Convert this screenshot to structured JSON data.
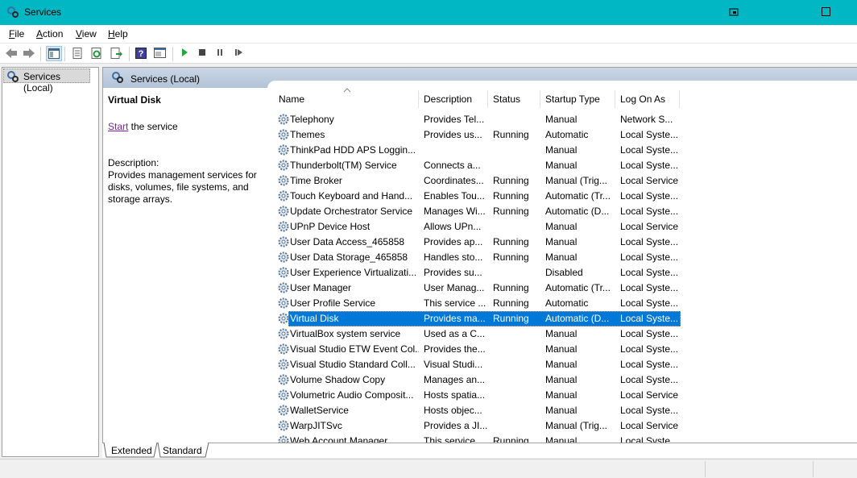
{
  "window": {
    "title": "Services",
    "icon": "services-gear-icon"
  },
  "menu": [
    {
      "label": "File",
      "key": "F",
      "rest": "ile"
    },
    {
      "label": "Action",
      "key": "A",
      "rest": "ction"
    },
    {
      "label": "View",
      "key": "V",
      "rest": "iew"
    },
    {
      "label": "Help",
      "key": "H",
      "rest": "elp"
    }
  ],
  "toolbar": {
    "icons": [
      "back-arrow-icon",
      "forward-arrow-icon",
      "show-hide-tree-icon",
      "properties-icon",
      "refresh-icon",
      "export-list-icon",
      "help-icon",
      "show-action-pane-icon",
      "start-service-icon",
      "stop-service-icon",
      "pause-service-icon",
      "restart-service-icon"
    ]
  },
  "tree": {
    "root_label": "Services (Local)"
  },
  "pane_header": "Services (Local)",
  "details": {
    "title": "Virtual Disk",
    "start_link": "Start",
    "start_rest": " the service",
    "description_label": "Description:",
    "description_text": "Provides management services for disks, volumes, file systems, and storage arrays."
  },
  "columns": [
    "Name",
    "Description",
    "Status",
    "Startup Type",
    "Log On As"
  ],
  "rows": [
    {
      "name": "Telephony",
      "desc": "Provides Tel...",
      "status": "",
      "startup": "Manual",
      "logon": "Network S..."
    },
    {
      "name": "Themes",
      "desc": "Provides us...",
      "status": "Running",
      "startup": "Automatic",
      "logon": "Local Syste..."
    },
    {
      "name": "ThinkPad HDD APS Loggin...",
      "desc": "",
      "status": "",
      "startup": "Manual",
      "logon": "Local Syste..."
    },
    {
      "name": "Thunderbolt(TM) Service",
      "desc": "Connects a...",
      "status": "",
      "startup": "Manual",
      "logon": "Local Syste..."
    },
    {
      "name": "Time Broker",
      "desc": "Coordinates...",
      "status": "Running",
      "startup": "Manual (Trig...",
      "logon": "Local Service"
    },
    {
      "name": "Touch Keyboard and Hand...",
      "desc": "Enables Tou...",
      "status": "Running",
      "startup": "Automatic (Tr...",
      "logon": "Local Syste..."
    },
    {
      "name": "Update Orchestrator Service",
      "desc": "Manages Wi...",
      "status": "Running",
      "startup": "Automatic (D...",
      "logon": "Local Syste..."
    },
    {
      "name": "UPnP Device Host",
      "desc": "Allows UPn...",
      "status": "",
      "startup": "Manual",
      "logon": "Local Service"
    },
    {
      "name": "User Data Access_465858",
      "desc": "Provides ap...",
      "status": "Running",
      "startup": "Manual",
      "logon": "Local Syste..."
    },
    {
      "name": "User Data Storage_465858",
      "desc": "Handles sto...",
      "status": "Running",
      "startup": "Manual",
      "logon": "Local Syste..."
    },
    {
      "name": "User Experience Virtualizati...",
      "desc": "Provides su...",
      "status": "",
      "startup": "Disabled",
      "logon": "Local Syste..."
    },
    {
      "name": "User Manager",
      "desc": "User Manag...",
      "status": "Running",
      "startup": "Automatic (Tr...",
      "logon": "Local Syste..."
    },
    {
      "name": "User Profile Service",
      "desc": "This service ...",
      "status": "Running",
      "startup": "Automatic",
      "logon": "Local Syste..."
    },
    {
      "name": "Virtual Disk",
      "desc": "Provides ma...",
      "status": "Running",
      "startup": "Automatic (D...",
      "logon": "Local Syste...",
      "selected": true
    },
    {
      "name": "VirtualBox system service",
      "desc": "Used as a C...",
      "status": "",
      "startup": "Manual",
      "logon": "Local Syste..."
    },
    {
      "name": "Visual Studio ETW Event Col...",
      "desc": "Provides the...",
      "status": "",
      "startup": "Manual",
      "logon": "Local Syste..."
    },
    {
      "name": "Visual Studio Standard Coll...",
      "desc": "Visual Studi...",
      "status": "",
      "startup": "Manual",
      "logon": "Local Syste..."
    },
    {
      "name": "Volume Shadow Copy",
      "desc": "Manages an...",
      "status": "",
      "startup": "Manual",
      "logon": "Local Syste..."
    },
    {
      "name": "Volumetric Audio Composit...",
      "desc": "Hosts spatia...",
      "status": "",
      "startup": "Manual",
      "logon": "Local Service"
    },
    {
      "name": "WalletService",
      "desc": "Hosts objec...",
      "status": "",
      "startup": "Manual",
      "logon": "Local Syste..."
    },
    {
      "name": "WarpJITSvc",
      "desc": "Provides a JI...",
      "status": "",
      "startup": "Manual (Trig...",
      "logon": "Local Service"
    },
    {
      "name": "Web Account Manager",
      "desc": "This service ...",
      "status": "Running",
      "startup": "Manual",
      "logon": "Local Syste..."
    }
  ],
  "tabs": [
    "Extended",
    "Standard"
  ],
  "colors": {
    "titlebar": "#00b7c3",
    "selection": "#0078d7",
    "header_band": "#b3c3d7",
    "link": "#7a1fa2"
  }
}
